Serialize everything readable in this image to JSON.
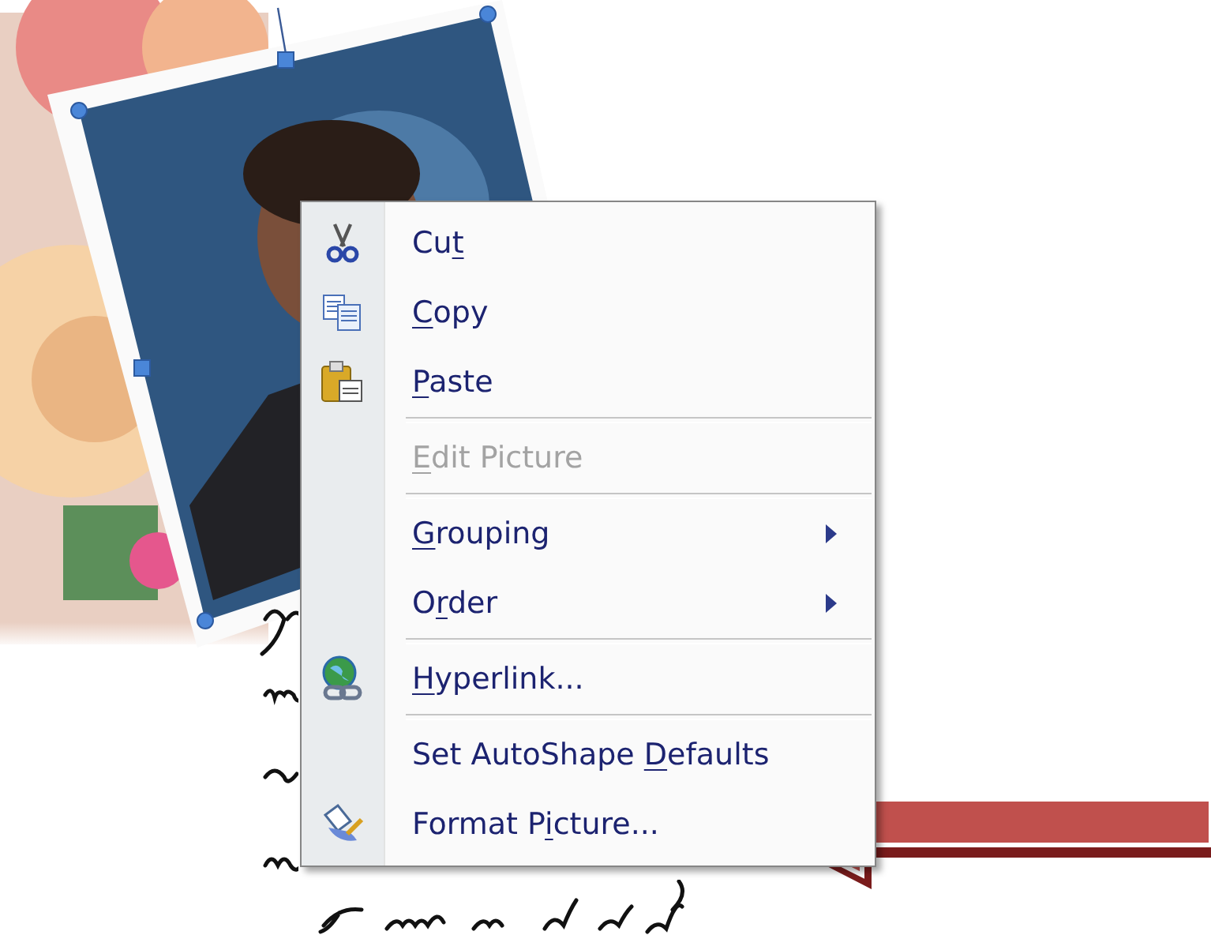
{
  "menu": {
    "items": [
      {
        "kind": "item",
        "label": [
          {
            "text": "Cu",
            "underlined": false
          },
          {
            "text": "t",
            "underlined": true
          }
        ],
        "disabled": false,
        "submenu": false
      },
      {
        "kind": "item",
        "label": [
          {
            "text": "C",
            "underlined": true
          },
          {
            "text": "opy",
            "underlined": false
          }
        ],
        "disabled": false,
        "submenu": false
      },
      {
        "kind": "item",
        "label": [
          {
            "text": "P",
            "underlined": true
          },
          {
            "text": "aste",
            "underlined": false
          }
        ],
        "disabled": false,
        "submenu": false
      },
      {
        "kind": "separator"
      },
      {
        "kind": "item",
        "label": [
          {
            "text": "E",
            "underlined": true
          },
          {
            "text": "dit Picture",
            "underlined": false
          }
        ],
        "disabled": true,
        "submenu": false
      },
      {
        "kind": "separator"
      },
      {
        "kind": "item",
        "label": [
          {
            "text": "G",
            "underlined": true
          },
          {
            "text": "rouping",
            "underlined": false
          }
        ],
        "disabled": false,
        "submenu": true
      },
      {
        "kind": "item",
        "label": [
          {
            "text": "O",
            "underlined": false
          },
          {
            "text": "r",
            "underlined": true
          },
          {
            "text": "der",
            "underlined": false
          }
        ],
        "disabled": false,
        "submenu": true
      },
      {
        "kind": "separator"
      },
      {
        "kind": "item",
        "label": [
          {
            "text": "H",
            "underlined": true
          },
          {
            "text": "yperlink...",
            "underlined": false
          }
        ],
        "disabled": false,
        "submenu": false
      },
      {
        "kind": "separator"
      },
      {
        "kind": "item",
        "label": [
          {
            "text": "Set AutoShape ",
            "underlined": false
          },
          {
            "text": "D",
            "underlined": true
          },
          {
            "text": "efaults",
            "underlined": false
          }
        ],
        "disabled": false,
        "submenu": false
      },
      {
        "kind": "item",
        "label": [
          {
            "text": "Format P",
            "underlined": false
          },
          {
            "text": "i",
            "underlined": true
          },
          {
            "text": "cture...",
            "underlined": false
          }
        ],
        "disabled": false,
        "submenu": false
      }
    ]
  }
}
